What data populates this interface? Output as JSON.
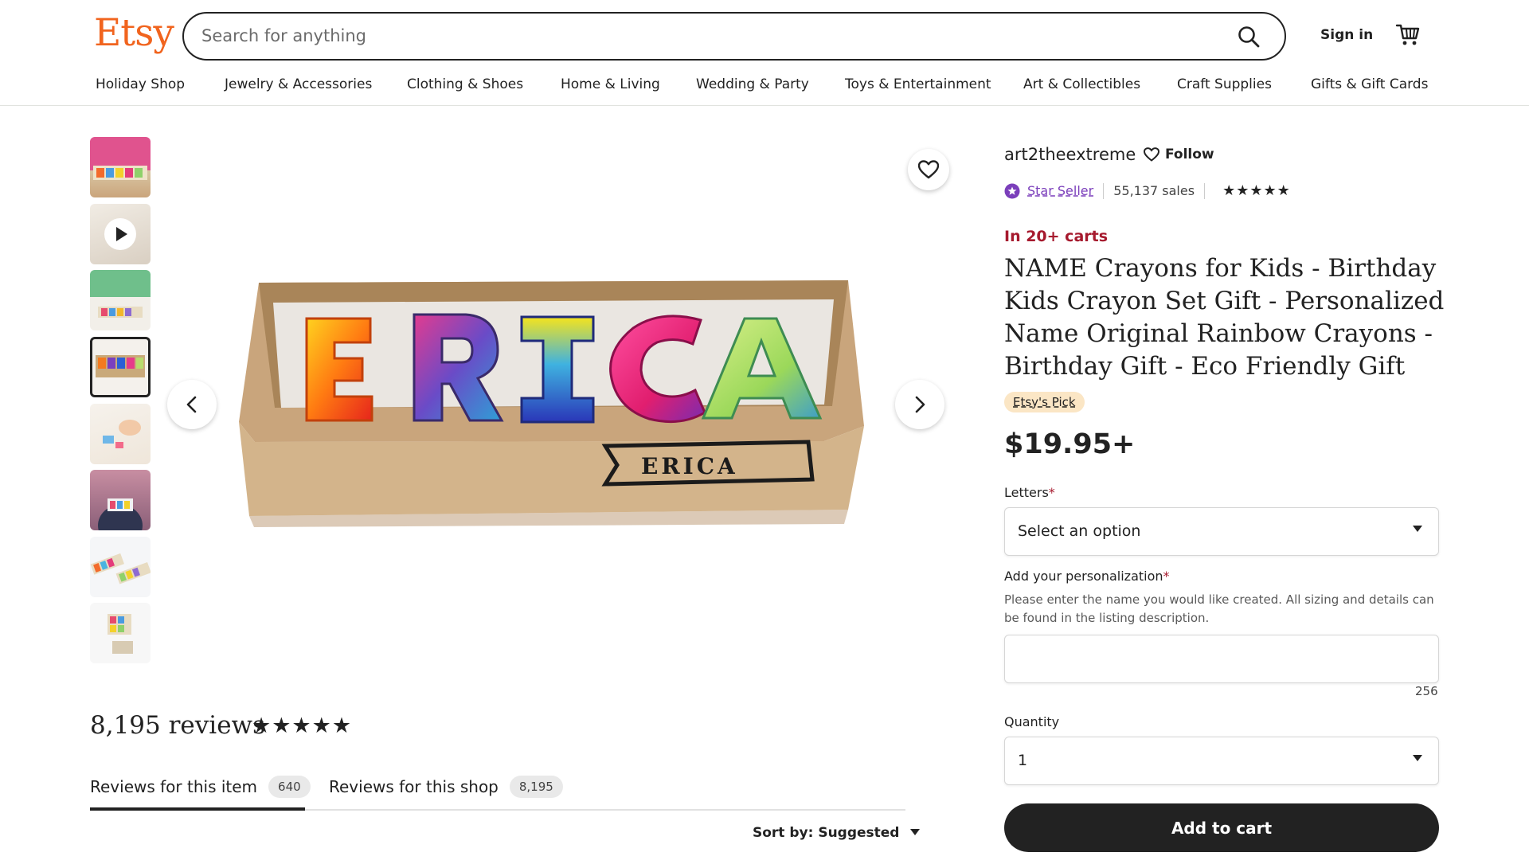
{
  "header": {
    "logo": "Etsy",
    "search_placeholder": "Search for anything",
    "sign_in": "Sign in"
  },
  "nav": {
    "items": [
      "Holiday Shop",
      "Jewelry & Accessories",
      "Clothing & Shoes",
      "Home & Living",
      "Wedding & Party",
      "Toys & Entertainment",
      "Art & Collectibles",
      "Craft Supplies",
      "Gifts & Gift Cards"
    ]
  },
  "gallery": {
    "selected_index": 3,
    "main_image_text": "ERICA",
    "box_label": "ERICA"
  },
  "shop": {
    "name": "art2theextreme",
    "follow": "Follow",
    "star_seller": "Star Seller",
    "sales": "55,137 sales",
    "stars": "★★★★★"
  },
  "listing": {
    "in_carts": "In 20+ carts",
    "title": "NAME Crayons for Kids - Birthday Kids Crayon Set Gift - Personalized Name Original Rainbow Crayons - Birthday Gift - Eco Friendly Gift",
    "pick": "Etsy's Pick",
    "price": "$19.95+",
    "letters_label": "Letters",
    "letters_value": "Select an option",
    "personalization_label": "Add your personalization",
    "personalization_hint": "Please enter the name you would like created. All sizing and details can be found in the listing description.",
    "personalization_value": "",
    "char_count": "256",
    "quantity_label": "Quantity",
    "quantity_value": "1",
    "add_to_cart": "Add to cart",
    "required_mark": "*"
  },
  "reviews": {
    "count": "8,195 reviews",
    "stars": "★★★★★",
    "tab_item": "Reviews for this item",
    "tab_item_count": "640",
    "tab_shop": "Reviews for this shop",
    "tab_shop_count": "8,195",
    "sort": "Sort by: Suggested"
  },
  "colors": {
    "brand": "#f1641e",
    "star_seller": "#7b3fbb",
    "urgency": "#a61a2e",
    "pick_bg": "#fbe6c5"
  }
}
